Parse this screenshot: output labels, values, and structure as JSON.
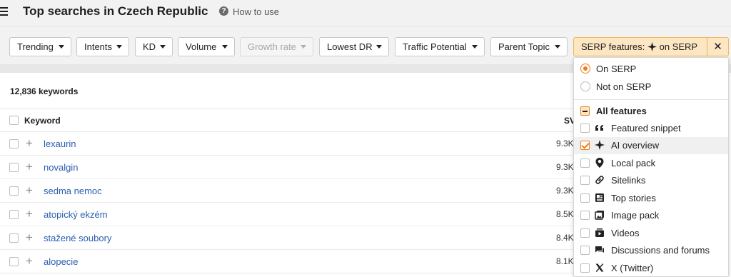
{
  "header": {
    "title": "Top searches in Czech Republic",
    "help_label": "How to use"
  },
  "filters": [
    {
      "label": "Trending"
    },
    {
      "label": "Intents"
    },
    {
      "label": "KD"
    },
    {
      "label": "Volume"
    },
    {
      "label": "Growth rate"
    },
    {
      "label": "Lowest DR"
    },
    {
      "label": "Traffic Potential"
    },
    {
      "label": "Parent Topic"
    }
  ],
  "serp_filter": {
    "prefix": "SERP features:",
    "value": "on SERP",
    "close": "✕"
  },
  "results": {
    "count": "12,836 keywords",
    "col_keyword": "Keyword",
    "col_volume": "SV"
  },
  "rows": [
    {
      "keyword": "lexaurin",
      "volume": "9.3K"
    },
    {
      "keyword": "novalgin",
      "volume": "9.3K"
    },
    {
      "keyword": "sedma nemoc",
      "volume": "9.3K"
    },
    {
      "keyword": "atopický ekzém",
      "volume": "8.5K"
    },
    {
      "keyword": "stažené soubory",
      "volume": "8.4K"
    },
    {
      "keyword": "alopecie",
      "volume": "8.1K"
    }
  ],
  "dropdown": {
    "on_serp": "On SERP",
    "not_on_serp": "Not on SERP",
    "all_features": "All features",
    "features": [
      {
        "label": "Featured snippet",
        "icon": "quote-icon",
        "checked": false
      },
      {
        "label": "AI overview",
        "icon": "sparkle-icon",
        "checked": true
      },
      {
        "label": "Local pack",
        "icon": "map-pin-icon",
        "checked": false
      },
      {
        "label": "Sitelinks",
        "icon": "link-icon",
        "checked": false
      },
      {
        "label": "Top stories",
        "icon": "news-icon",
        "checked": false
      },
      {
        "label": "Image pack",
        "icon": "image-icon",
        "checked": false
      },
      {
        "label": "Videos",
        "icon": "video-icon",
        "checked": false
      },
      {
        "label": "Discussions and forums",
        "icon": "chat-icon",
        "checked": false
      },
      {
        "label": "X (Twitter)",
        "icon": "x-logo-icon",
        "checked": false
      }
    ]
  },
  "colors": {
    "accent": "#f07c19",
    "serp_filter_bg": "#fde6c2",
    "link": "#2a5db0"
  }
}
